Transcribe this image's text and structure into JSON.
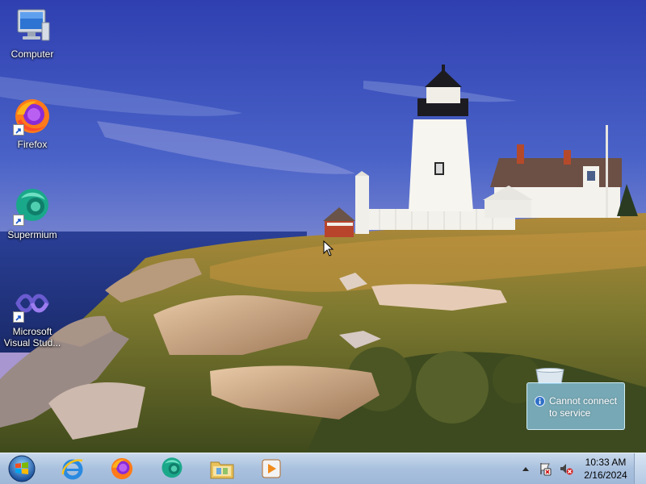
{
  "desktop": {
    "icons": [
      {
        "label": "Computer",
        "icon": "computer-icon"
      },
      {
        "label": "Firefox",
        "icon": "firefox-icon"
      },
      {
        "label": "Supermium",
        "icon": "supermium-icon"
      },
      {
        "label": "Microsoft Visual Stud...",
        "icon": "visual-studio-icon"
      }
    ]
  },
  "taskbar": {
    "start": {
      "icon": "windows-logo-icon"
    },
    "pinned": [
      {
        "name": "Internet Explorer",
        "icon": "internet-explorer-icon"
      },
      {
        "name": "Firefox",
        "icon": "firefox-icon"
      },
      {
        "name": "Supermium",
        "icon": "supermium-icon"
      },
      {
        "name": "Windows Explorer",
        "icon": "folder-icon"
      },
      {
        "name": "Windows Media Player",
        "icon": "media-player-icon"
      }
    ],
    "tray": {
      "icons": [
        "show-hidden-icons-arrow",
        "action-center-icon",
        "volume-muted-icon"
      ],
      "time": "10:33 AM",
      "date": "2/16/2024"
    }
  },
  "notification": {
    "text": "Cannot connect to service",
    "icon": "info-icon"
  },
  "colors": {
    "sky": "#3a4fb8",
    "taskbar": "#a9c1de",
    "notification": "#8ccdf0"
  }
}
